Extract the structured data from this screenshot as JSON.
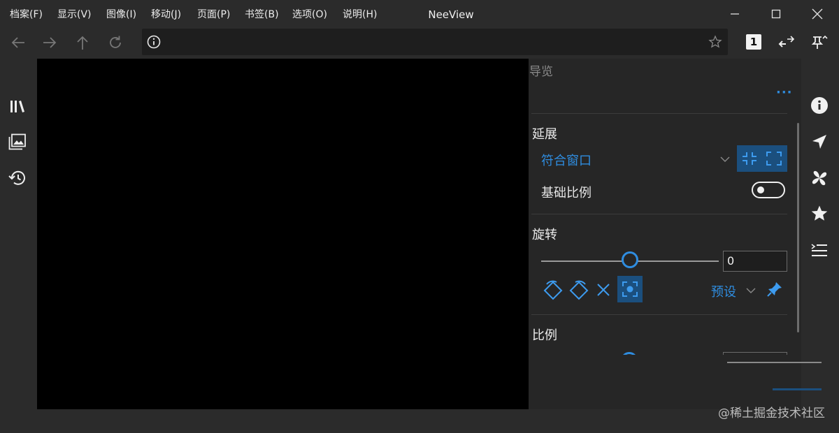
{
  "menu": [
    "档案(F)",
    "显示(V)",
    "图像(I)",
    "移动(J)",
    "页面(P)",
    "书签(B)",
    "选项(O)",
    "说明(H)"
  ],
  "app_title": "NeeView",
  "toolbar": {
    "page_mode": "1"
  },
  "panel": {
    "heading": "导览",
    "more": "···",
    "stretch": {
      "title": "延展",
      "mode": "符合窗口",
      "base_scale_label": "基础比例",
      "base_scale_on": false
    },
    "rotate": {
      "title": "旋转",
      "angle": "0",
      "slider_fraction": 0.5,
      "preset_label": "预设"
    },
    "scale": {
      "title": "比例"
    }
  },
  "watermark": "@稀土掘金技术社区",
  "colors": {
    "accent": "#2f8de0",
    "accent_bg": "#1b4f7e",
    "viewer_bg": "#000000",
    "panel_bg": "#262626"
  }
}
